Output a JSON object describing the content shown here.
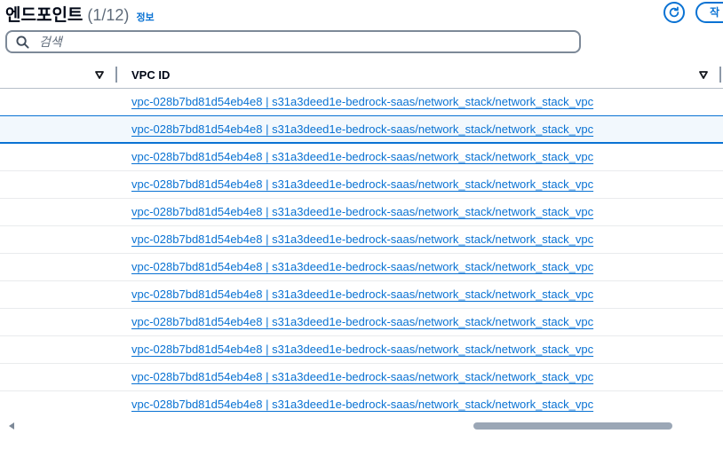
{
  "header": {
    "title": "엔드포인트",
    "count": "(1/12)",
    "info_label": "정보",
    "create_label": "작",
    "refresh_icon": "refresh-icon"
  },
  "search": {
    "placeholder": "검색",
    "value": ""
  },
  "table": {
    "columns": [
      {
        "label": ""
      },
      {
        "label": "VPC ID"
      }
    ],
    "rows": [
      {
        "vpc": "vpc-028b7bd81d54eb4e8 | s31a3deed1e-bedrock-saas/network_stack/network_stack_vpc",
        "selected": false
      },
      {
        "vpc": "vpc-028b7bd81d54eb4e8 | s31a3deed1e-bedrock-saas/network_stack/network_stack_vpc",
        "selected": true
      },
      {
        "vpc": "vpc-028b7bd81d54eb4e8 | s31a3deed1e-bedrock-saas/network_stack/network_stack_vpc",
        "selected": false
      },
      {
        "vpc": "vpc-028b7bd81d54eb4e8 | s31a3deed1e-bedrock-saas/network_stack/network_stack_vpc",
        "selected": false
      },
      {
        "vpc": "vpc-028b7bd81d54eb4e8 | s31a3deed1e-bedrock-saas/network_stack/network_stack_vpc",
        "selected": false
      },
      {
        "vpc": "vpc-028b7bd81d54eb4e8 | s31a3deed1e-bedrock-saas/network_stack/network_stack_vpc",
        "selected": false
      },
      {
        "vpc": "vpc-028b7bd81d54eb4e8 | s31a3deed1e-bedrock-saas/network_stack/network_stack_vpc",
        "selected": false
      },
      {
        "vpc": "vpc-028b7bd81d54eb4e8 | s31a3deed1e-bedrock-saas/network_stack/network_stack_vpc",
        "selected": false
      },
      {
        "vpc": "vpc-028b7bd81d54eb4e8 | s31a3deed1e-bedrock-saas/network_stack/network_stack_vpc",
        "selected": false
      },
      {
        "vpc": "vpc-028b7bd81d54eb4e8 | s31a3deed1e-bedrock-saas/network_stack/network_stack_vpc",
        "selected": false
      },
      {
        "vpc": "vpc-028b7bd81d54eb4e8 | s31a3deed1e-bedrock-saas/network_stack/network_stack_vpc",
        "selected": false
      },
      {
        "vpc": "vpc-028b7bd81d54eb4e8 | s31a3deed1e-bedrock-saas/network_stack/network_stack_vpc",
        "selected": false
      }
    ]
  },
  "colors": {
    "link": "#0972d3",
    "selected_row_bg": "#f2f8fd",
    "selected_row_border": "#0972d3",
    "heading": "#000716",
    "muted": "#5f6b7a"
  }
}
